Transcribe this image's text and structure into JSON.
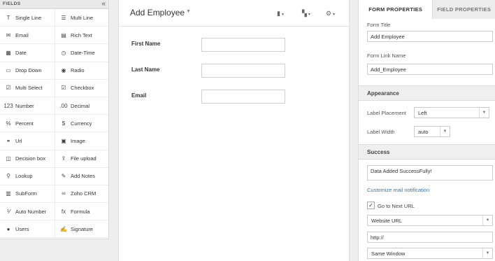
{
  "fields_panel": {
    "title": "FIELDS",
    "collapse_icon": "«",
    "items": [
      {
        "label": "Single Line",
        "icon": "T"
      },
      {
        "label": "Multi Line",
        "icon": "☰"
      },
      {
        "label": "Email",
        "icon": "✉"
      },
      {
        "label": "Rich Text",
        "icon": "▤"
      },
      {
        "label": "Date",
        "icon": "▦"
      },
      {
        "label": "Date-Time",
        "icon": "◷"
      },
      {
        "label": "Drop Down",
        "icon": "▭"
      },
      {
        "label": "Radio",
        "icon": "◉"
      },
      {
        "label": "Multi Select",
        "icon": "☑"
      },
      {
        "label": "Checkbox",
        "icon": "☑"
      },
      {
        "label": "Number",
        "icon": "123"
      },
      {
        "label": "Decimal",
        "icon": ".00"
      },
      {
        "label": "Percent",
        "icon": "%"
      },
      {
        "label": "Currency",
        "icon": "$"
      },
      {
        "label": "Url",
        "icon": "⚭"
      },
      {
        "label": "Image",
        "icon": "▣"
      },
      {
        "label": "Decision box",
        "icon": "◫"
      },
      {
        "label": "File upload",
        "icon": "⇪"
      },
      {
        "label": "Lookup",
        "icon": "⚲"
      },
      {
        "label": "Add Notes",
        "icon": "✎"
      },
      {
        "label": "SubForm",
        "icon": "▥"
      },
      {
        "label": "Zoho CRM",
        "icon": "∞"
      },
      {
        "label": "Auto Number",
        "icon": "⅟"
      },
      {
        "label": "Formula",
        "icon": "fx"
      },
      {
        "label": "Users",
        "icon": "●"
      },
      {
        "label": "Signature",
        "icon": "✍"
      }
    ]
  },
  "form": {
    "title": "Add Employee",
    "title_caret": "▼",
    "fields": [
      {
        "label": "First Name",
        "value": ""
      },
      {
        "label": "Last Name",
        "value": ""
      },
      {
        "label": "Email",
        "value": ""
      }
    ]
  },
  "toolbar": {
    "chart_icon": "▮",
    "layout_icon": "▚",
    "settings_icon": "⚙",
    "caret": "▼"
  },
  "properties": {
    "tabs": [
      {
        "label": "FORM PROPERTIES",
        "active": true
      },
      {
        "label": "FIELD PROPERTIES",
        "active": false
      }
    ],
    "form_title_label": "Form Title",
    "form_title_value": "Add Employee",
    "form_link_label": "Form Link Name",
    "form_link_value": "Add_Employee",
    "appearance": {
      "heading": "Appearance",
      "label_placement_label": "Label Placement",
      "label_placement_value": "Left",
      "label_width_label": "Label Width",
      "label_width_value": "auto"
    },
    "success": {
      "heading": "Success",
      "message": "Data Added SuccessFully!",
      "mail_link": "Customize mail notification",
      "next_url_label": "Go to Next URL",
      "next_url_checked": true,
      "url_type": "Website URL",
      "url_value": "http://",
      "window_option": "Same Window"
    },
    "select_arrow": "▼"
  },
  "colors": {
    "accent_link": "#2a7ab8",
    "background": "#eeeeee"
  }
}
